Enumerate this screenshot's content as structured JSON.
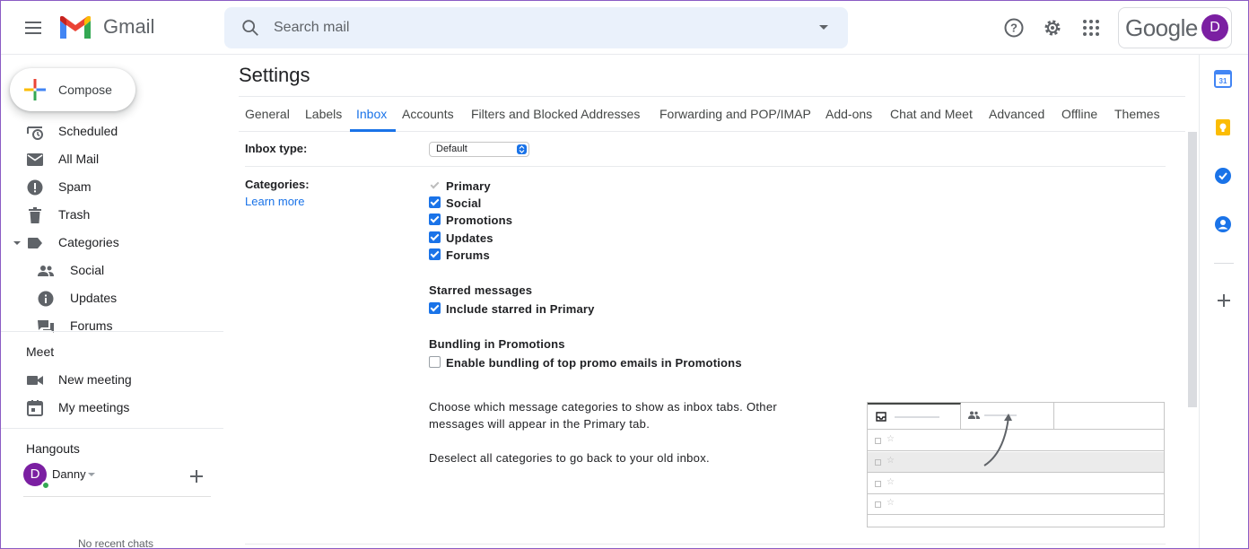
{
  "header": {
    "app_name": "Gmail",
    "search_placeholder": "Search mail",
    "google_text": "Google",
    "avatar_initial": "D"
  },
  "sidebar": {
    "compose_label": "Compose",
    "items": [
      {
        "label": "Scheduled",
        "icon": "scheduled-icon"
      },
      {
        "label": "All Mail",
        "icon": "all-mail-icon"
      },
      {
        "label": "Spam",
        "icon": "spam-icon"
      },
      {
        "label": "Trash",
        "icon": "trash-icon"
      },
      {
        "label": "Categories",
        "icon": "label-icon"
      },
      {
        "label": "Social",
        "icon": "social-icon"
      },
      {
        "label": "Updates",
        "icon": "updates-icon"
      },
      {
        "label": "Forums",
        "icon": "forums-icon"
      }
    ],
    "meet": {
      "title": "Meet",
      "items": [
        {
          "label": "New meeting",
          "icon": "video-icon"
        },
        {
          "label": "My meetings",
          "icon": "calendar-icon"
        }
      ]
    },
    "hangouts": {
      "title": "Hangouts",
      "user": "Danny",
      "user_initial": "D",
      "no_chats": "No recent chats"
    }
  },
  "settings": {
    "title": "Settings",
    "tabs": [
      "General",
      "Labels",
      "Inbox",
      "Accounts",
      "Filters and Blocked Addresses",
      "Forwarding and POP/IMAP",
      "Add-ons",
      "Chat and Meet",
      "Advanced",
      "Offline",
      "Themes"
    ],
    "active_tab": "Inbox",
    "inbox_type_label": "Inbox type:",
    "inbox_type_value": "Default",
    "categories_label": "Categories:",
    "learn_more": "Learn more",
    "categories": [
      {
        "label": "Primary",
        "checked": true,
        "disabled": true
      },
      {
        "label": "Social",
        "checked": true
      },
      {
        "label": "Promotions",
        "checked": true
      },
      {
        "label": "Updates",
        "checked": true
      },
      {
        "label": "Forums",
        "checked": true
      }
    ],
    "starred_heading": "Starred messages",
    "starred_option": "Include starred in Primary",
    "bundling_heading": "Bundling in Promotions",
    "bundling_option": "Enable bundling of top promo emails in Promotions",
    "desc_line1": "Choose which message categories to show as inbox tabs. Other",
    "desc_line2": "messages will appear in the Primary tab.",
    "desc_deselect": "Deselect all categories to go back to your old inbox."
  },
  "colors": {
    "accent": "#1a73e8",
    "avatar": "#7b1fa2",
    "frame": "#8b5cc4"
  }
}
